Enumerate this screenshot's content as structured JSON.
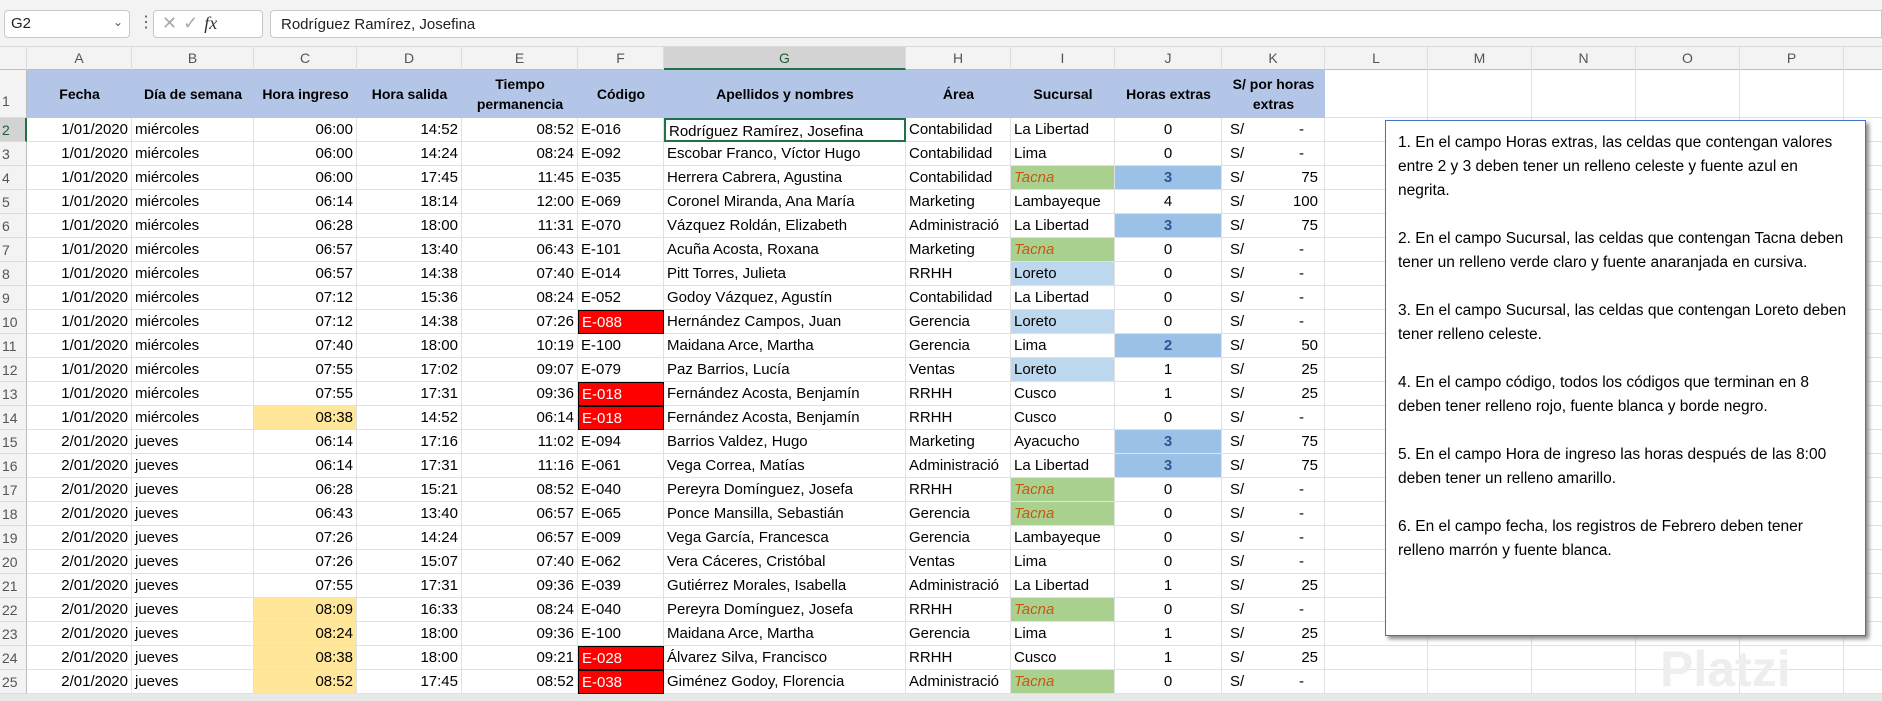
{
  "formula_bar": {
    "name_box": "G2",
    "value": "Rodríguez Ramírez, Josefina",
    "fx": "fx"
  },
  "columns": [
    "A",
    "B",
    "C",
    "D",
    "E",
    "F",
    "G",
    "H",
    "I",
    "J",
    "K",
    "L",
    "M",
    "N",
    "O",
    "P"
  ],
  "headers": [
    "Fecha",
    "Día de semana",
    "Hora ingreso",
    "Hora salida",
    "Tiempo permanencia",
    "Código",
    "Apellidos y nombres",
    "Área",
    "Sucursal",
    "Horas extras",
    "S/ por horas extras"
  ],
  "rows": [
    [
      "1/01/2020",
      "miércoles",
      "06:00",
      "14:52",
      "08:52",
      "E-016",
      "Rodríguez Ramírez, Josefina",
      "Contabilidad",
      "La Libertad",
      "0",
      "S/",
      "-"
    ],
    [
      "1/01/2020",
      "miércoles",
      "06:00",
      "14:24",
      "08:24",
      "E-092",
      "Escobar Franco, Víctor Hugo",
      "Contabilidad",
      "Lima",
      "0",
      "S/",
      "-"
    ],
    [
      "1/01/2020",
      "miércoles",
      "06:00",
      "17:45",
      "11:45",
      "E-035",
      "Herrera Cabrera, Agustina",
      "Contabilidad",
      "Tacna",
      "3",
      "S/",
      "75"
    ],
    [
      "1/01/2020",
      "miércoles",
      "06:14",
      "18:14",
      "12:00",
      "E-069",
      "Coronel Miranda, Ana María",
      "Marketing",
      "Lambayeque",
      "4",
      "S/",
      "100"
    ],
    [
      "1/01/2020",
      "miércoles",
      "06:28",
      "18:00",
      "11:31",
      "E-070",
      "Vázquez Roldán, Elizabeth",
      "Administració",
      "La Libertad",
      "3",
      "S/",
      "75"
    ],
    [
      "1/01/2020",
      "miércoles",
      "06:57",
      "13:40",
      "06:43",
      "E-101",
      "Acuña Acosta, Roxana",
      "Marketing",
      "Tacna",
      "0",
      "S/",
      "-"
    ],
    [
      "1/01/2020",
      "miércoles",
      "06:57",
      "14:38",
      "07:40",
      "E-014",
      "Pitt Torres, Julieta",
      "RRHH",
      "Loreto",
      "0",
      "S/",
      "-"
    ],
    [
      "1/01/2020",
      "miércoles",
      "07:12",
      "15:36",
      "08:24",
      "E-052",
      "Godoy Vázquez, Agustín",
      "Contabilidad",
      "La Libertad",
      "0",
      "S/",
      "-"
    ],
    [
      "1/01/2020",
      "miércoles",
      "07:12",
      "14:38",
      "07:26",
      "E-088",
      "Hernández Campos, Juan",
      "Gerencia",
      "Loreto",
      "0",
      "S/",
      "-"
    ],
    [
      "1/01/2020",
      "miércoles",
      "07:40",
      "18:00",
      "10:19",
      "E-100",
      "Maidana Arce, Martha",
      "Gerencia",
      "Lima",
      "2",
      "S/",
      "50"
    ],
    [
      "1/01/2020",
      "miércoles",
      "07:55",
      "17:02",
      "09:07",
      "E-079",
      "Paz Barrios, Lucía",
      "Ventas",
      "Loreto",
      "1",
      "S/",
      "25"
    ],
    [
      "1/01/2020",
      "miércoles",
      "07:55",
      "17:31",
      "09:36",
      "E-018",
      "Fernández Acosta, Benjamín",
      "RRHH",
      "Cusco",
      "1",
      "S/",
      "25"
    ],
    [
      "1/01/2020",
      "miércoles",
      "08:38",
      "14:52",
      "06:14",
      "E-018",
      "Fernández Acosta, Benjamín",
      "RRHH",
      "Cusco",
      "0",
      "S/",
      "-"
    ],
    [
      "2/01/2020",
      "jueves",
      "06:14",
      "17:16",
      "11:02",
      "E-094",
      "Barrios Valdez, Hugo",
      "Marketing",
      "Ayacucho",
      "3",
      "S/",
      "75"
    ],
    [
      "2/01/2020",
      "jueves",
      "06:14",
      "17:31",
      "11:16",
      "E-061",
      "Vega Correa, Matías",
      "Administració",
      "La Libertad",
      "3",
      "S/",
      "75"
    ],
    [
      "2/01/2020",
      "jueves",
      "06:28",
      "15:21",
      "08:52",
      "E-040",
      "Pereyra Domínguez, Josefa",
      "RRHH",
      "Tacna",
      "0",
      "S/",
      "-"
    ],
    [
      "2/01/2020",
      "jueves",
      "06:43",
      "13:40",
      "06:57",
      "E-065",
      "Ponce Mansilla, Sebastián",
      "Gerencia",
      "Tacna",
      "0",
      "S/",
      "-"
    ],
    [
      "2/01/2020",
      "jueves",
      "07:26",
      "14:24",
      "06:57",
      "E-009",
      "Vega García, Francesca",
      "Gerencia",
      "Lambayeque",
      "0",
      "S/",
      "-"
    ],
    [
      "2/01/2020",
      "jueves",
      "07:26",
      "15:07",
      "07:40",
      "E-062",
      "Vera Cáceres, Cristóbal",
      "Ventas",
      "Lima",
      "0",
      "S/",
      "-"
    ],
    [
      "2/01/2020",
      "jueves",
      "07:55",
      "17:31",
      "09:36",
      "E-039",
      "Gutiérrez Morales, Isabella",
      "Administració",
      "La Libertad",
      "1",
      "S/",
      "25"
    ],
    [
      "2/01/2020",
      "jueves",
      "08:09",
      "16:33",
      "08:24",
      "E-040",
      "Pereyra Domínguez, Josefa",
      "RRHH",
      "Tacna",
      "0",
      "S/",
      "-"
    ],
    [
      "2/01/2020",
      "jueves",
      "08:24",
      "18:00",
      "09:36",
      "E-100",
      "Maidana Arce, Martha",
      "Gerencia",
      "Lima",
      "1",
      "S/",
      "25"
    ],
    [
      "2/01/2020",
      "jueves",
      "08:38",
      "18:00",
      "09:21",
      "E-028",
      "Álvarez Silva, Francisco",
      "RRHH",
      "Cusco",
      "1",
      "S/",
      "25"
    ],
    [
      "2/01/2020",
      "jueves",
      "08:52",
      "17:45",
      "08:52",
      "E-038",
      "Giménez Godoy, Florencia",
      "Administració",
      "Tacna",
      "0",
      "S/",
      "-"
    ]
  ],
  "note": [
    "1. En el campo Horas extras, las celdas que contengan valores entre 2 y 3 deben tener un relleno celeste y fuente azul en negrita.",
    "2. En el campo Sucursal, las celdas que contengan Tacna deben tener un relleno verde claro y fuente anaranjada en cursiva.",
    "3. En el campo Sucursal, las celdas que contengan Loreto deben tener relleno celeste.",
    "4. En el campo código, todos los códigos que terminan en 8 deben tener relleno rojo, fuente blanca y borde negro.",
    "5. En el campo Hora de ingreso las horas después de las 8:00 deben tener un relleno amarillo.",
    "6. En el campo fecha, los registros de Febrero deben tener relleno marrón y fuente blanca."
  ],
  "watermark": "Platzi"
}
